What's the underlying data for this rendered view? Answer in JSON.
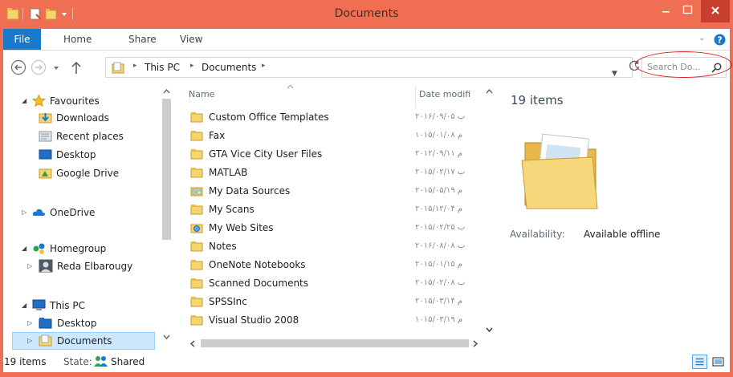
{
  "window": {
    "title": "Documents"
  },
  "ribbon": {
    "tabs": [
      "File",
      "Home",
      "Share",
      "View"
    ]
  },
  "address": {
    "crumbs": [
      "This PC",
      "Documents"
    ]
  },
  "search": {
    "placeholder": "Search Do..."
  },
  "nav": {
    "favourites": {
      "label": "Favourites",
      "items": [
        "Downloads",
        "Recent places",
        "Desktop",
        "Google Drive"
      ]
    },
    "onedrive": "OneDrive",
    "homegroup": {
      "label": "Homegroup",
      "items": [
        "Reda Elbarougy"
      ]
    },
    "thispc": {
      "label": "This PC",
      "items": [
        "Desktop",
        "Documents"
      ]
    }
  },
  "columns": {
    "name": "Name",
    "date": "Date modifi"
  },
  "files": [
    {
      "name": "Custom Office Templates",
      "date": "۲۰۱۶/۰۹/۰۵ ب",
      "icon": "folder"
    },
    {
      "name": "Fax",
      "date": "۱۰۱۵/۰۱/۰۸ م",
      "icon": "folder"
    },
    {
      "name": "GTA Vice City User Files",
      "date": "۲۰۱۲/۰۹/۱۱ م",
      "icon": "folder"
    },
    {
      "name": "MATLAB",
      "date": "۲۰۱۵/۰۲/۱۷ ب",
      "icon": "folder"
    },
    {
      "name": "My Data Sources",
      "date": "۲۰۱۵/۰۵/۱۹ م",
      "icon": "data-sources"
    },
    {
      "name": "My Scans",
      "date": "۲۰۱۵/۱۲/۰۴ م",
      "icon": "folder"
    },
    {
      "name": "My Web Sites",
      "date": "۲۰۱۵/۰۲/۲۵ ب",
      "icon": "web-folder"
    },
    {
      "name": "Notes",
      "date": "۲۰۱۶/۰۸/۰۸ ب",
      "icon": "folder"
    },
    {
      "name": "OneNote Notebooks",
      "date": "۲۰۱۵/۰۱/۱۵ م",
      "icon": "folder"
    },
    {
      "name": "Scanned Documents",
      "date": "۲۰۱۵/۰۲/۰۸ ب",
      "icon": "folder"
    },
    {
      "name": "SPSSInc",
      "date": "۲۰۱۵/۰۳/۱۴ م",
      "icon": "folder"
    },
    {
      "name": "Visual Studio 2008",
      "date": "۱۰۱۵/۰۳/۱۹ م",
      "icon": "folder"
    }
  ],
  "details": {
    "count": "19 items",
    "availability_label": "Availability:",
    "availability_value": "Available offline"
  },
  "status": {
    "count": "19 items",
    "state_label": "State:",
    "state_value": "Shared"
  },
  "colors": {
    "titlebar": "#f06f52",
    "file_tab": "#1979ca",
    "selection": "#cce8ff",
    "search_highlight": "#e01b1b"
  }
}
